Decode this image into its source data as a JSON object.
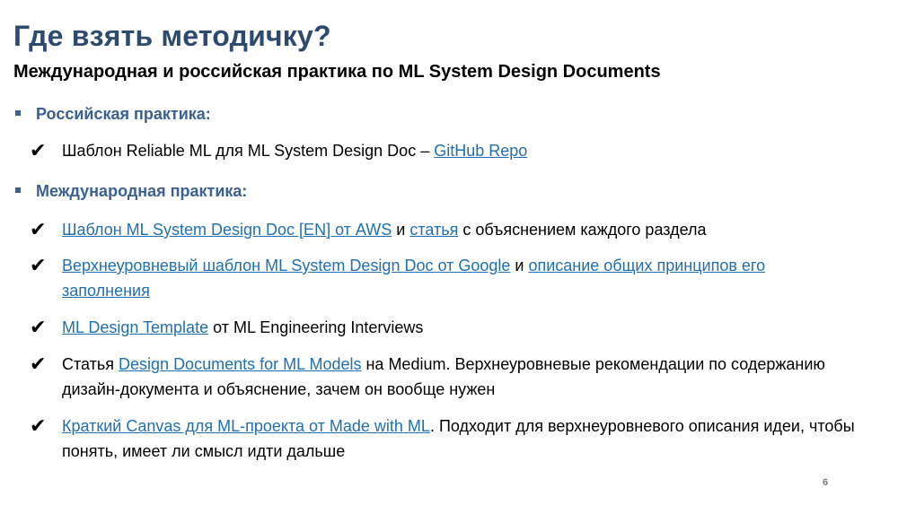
{
  "title": "Где взять методичку?",
  "subtitle": "Международная и российская практика по ML System Design Documents",
  "sections": {
    "russian": {
      "heading": "Российская практика:",
      "items": [
        {
          "prefix": "Шаблон Reliable ML для ML System Design Doc – ",
          "link": "GitHub Repo"
        }
      ]
    },
    "international": {
      "heading": "Международная практика:",
      "items": [
        {
          "link1": "Шаблон ML System Design Doc [EN] от AWS",
          "middle": " и ",
          "link2": "статья",
          "suffix": " с объяснением каждого раздела"
        },
        {
          "link1": "Верхнеуровневый шаблон ML System Design Doc от Google",
          "middle": " и ",
          "link2": "описание общих принципов его заполнения"
        },
        {
          "link1": "ML Design Template",
          "suffix": " от ML Engineering Interviews"
        },
        {
          "prefix": "Статья ",
          "link1": "Design Documents for ML Models",
          "suffix": " на Medium. Верхнеуровневые рекомендации по содержанию дизайн-документа и объяснение, зачем он вообще нужен"
        },
        {
          "link1": "Краткий Canvas для ML-проекта от Made with ML",
          "suffix": ". Подходит для верхнеуровневого описания идеи, чтобы понять, имеет ли смысл идти дальше"
        }
      ]
    }
  },
  "check_glyph": "✔",
  "page_number": "6"
}
